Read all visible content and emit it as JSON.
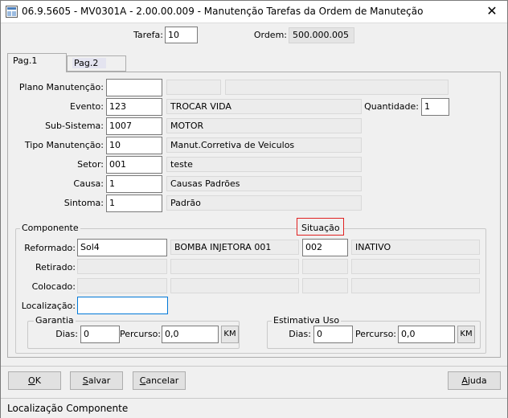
{
  "window": {
    "title": "06.9.5605 - MV0301A - 2.00.00.009 - Manutenção Tarefas da Ordem de Manuteção",
    "close_glyph": "✕"
  },
  "header": {
    "tarefa_label": "Tarefa:",
    "tarefa_value": "10",
    "ordem_label": "Ordem:",
    "ordem_value": "500.000.005"
  },
  "tabs": [
    {
      "label": "Pag.1",
      "active": true
    },
    {
      "label": "Pag.2",
      "active": false
    }
  ],
  "form": {
    "plano": {
      "label": "Plano Manutenção:",
      "value": "",
      "desc1": "",
      "desc2": ""
    },
    "evento": {
      "label": "Evento:",
      "value": "123",
      "desc": "TROCAR VIDA"
    },
    "quantidade": {
      "label": "Quantidade:",
      "value": "1"
    },
    "subsistema": {
      "label": "Sub-Sistema:",
      "value": "1007",
      "desc": "MOTOR"
    },
    "tipo": {
      "label": "Tipo Manutenção:",
      "value": "10",
      "desc": "Manut.Corretiva de Veiculos"
    },
    "setor": {
      "label": "Setor:",
      "value": "001",
      "desc": "teste"
    },
    "causa": {
      "label": "Causa:",
      "value": "1",
      "desc": "Causas Padrões"
    },
    "sintoma": {
      "label": "Sintoma:",
      "value": "1",
      "desc": "Padrão"
    }
  },
  "componente": {
    "title": "Componente",
    "situacao_title": "Situação",
    "reformado": {
      "label": "Reformado:",
      "value": "Sol4",
      "desc": "BOMBA INJETORA 001",
      "sit_code": "002",
      "sit_desc": "INATIVO"
    },
    "retirado": {
      "label": "Retirado:"
    },
    "colocado": {
      "label": "Colocado:"
    },
    "localizacao": {
      "label": "Localização:",
      "value": ""
    },
    "garantia": {
      "title": "Garantia",
      "dias_label": "Dias:",
      "dias_value": "0",
      "percurso_label": "Percurso:",
      "percurso_value": "0,0",
      "unit": "KM"
    },
    "estimativa": {
      "title": "Estimativa Uso",
      "dias_label": "Dias:",
      "dias_value": "0",
      "percurso_label": "Percurso:",
      "percurso_value": "0,0",
      "unit": "KM"
    }
  },
  "buttons": {
    "ok_u": "O",
    "ok_rest": "K",
    "salvar_u": "S",
    "salvar_rest": "alvar",
    "cancelar_u": "C",
    "cancelar_rest": "ancelar",
    "ajuda_u": "A",
    "ajuda_rest": "juda"
  },
  "status": {
    "text": "Localização Componente"
  },
  "colors": {
    "situacao_highlight": "#e02020",
    "focus_border": "#0078d7"
  }
}
